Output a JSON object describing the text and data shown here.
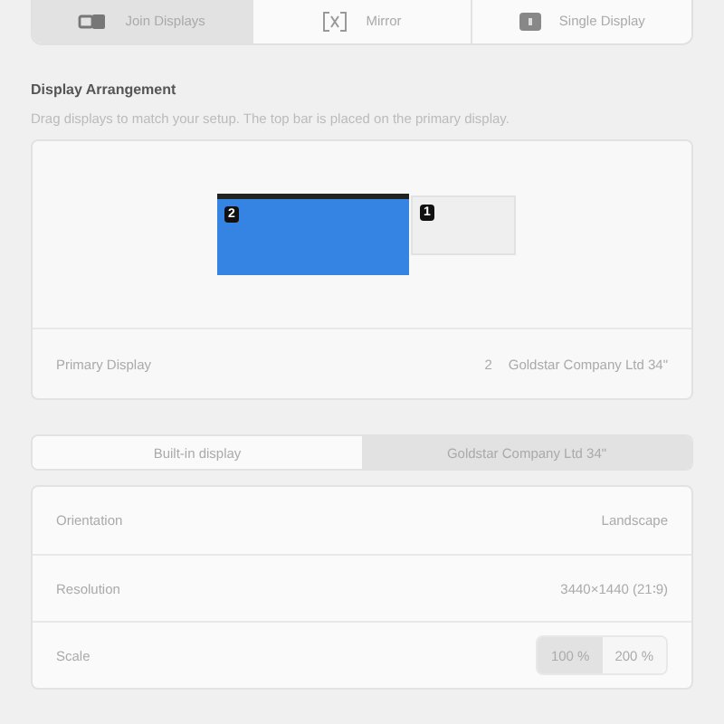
{
  "mode_tabs": [
    {
      "kind": "join",
      "label": "Join Displays",
      "selected": true
    },
    {
      "kind": "mirror",
      "label": "Mirror",
      "selected": false
    },
    {
      "kind": "single",
      "label": "Single Display",
      "selected": false
    }
  ],
  "arrangement": {
    "title": "Display Arrangement",
    "subtitle": "Drag displays to match your setup. The top bar is placed on the primary display.",
    "displays": [
      {
        "number": "2",
        "primary": true,
        "selected": true
      },
      {
        "number": "1",
        "primary": false,
        "selected": false
      }
    ],
    "primary_display": {
      "label": "Primary Display",
      "number": "2",
      "value": "Goldstar Company Ltd 34\""
    }
  },
  "display_tabs": [
    {
      "label": "Built-in display",
      "selected": false
    },
    {
      "label": "Goldstar Company Ltd 34\"",
      "selected": true
    }
  ],
  "settings": [
    {
      "kind": "value",
      "label": "Orientation",
      "value": "Landscape"
    },
    {
      "kind": "value",
      "label": "Resolution",
      "value": "3440×1440 (21∶9)"
    },
    {
      "kind": "toggle",
      "label": "Scale",
      "options": [
        {
          "label": "100 %",
          "selected": true
        },
        {
          "label": "200 %",
          "selected": false
        }
      ]
    }
  ]
}
